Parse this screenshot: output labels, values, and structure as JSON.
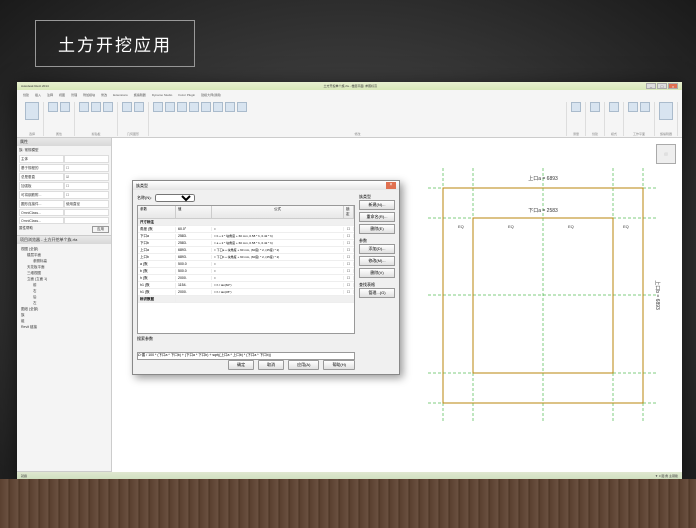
{
  "slide_title": "土方开挖应用",
  "app": {
    "title_left": "Autodesk Revit 2014",
    "title_doc": "土方开挖单个族.rfa - 楼层平面: 参照标高",
    "search_placeholder": "输入关键字或短语",
    "ribbon_tabs": [
      "创建",
      "插入",
      "注释",
      "视图",
      "管理",
      "附加模块",
      "修改",
      "Extensions",
      "族编辑器",
      "Dynamo Studio",
      "Fuzor Plugin",
      "建模大师(通用)"
    ],
    "ribbon_groups": [
      {
        "label": "选择"
      },
      {
        "label": "属性"
      },
      {
        "label": "剪贴板"
      },
      {
        "label": "几何图形"
      },
      {
        "label": "修改"
      },
      {
        "label": "测量"
      },
      {
        "label": "创建"
      },
      {
        "label": "模式"
      },
      {
        "label": "工作平面"
      },
      {
        "label": "族编辑器"
      }
    ]
  },
  "props_panel": {
    "title": "属性",
    "type_label": "族: 常规模型",
    "edit_type": "编辑类型",
    "groups": {
      "约束": "约束",
      "结构": "结构",
      "尺寸标注": "尺寸标注",
      "标识数据": "标识数据"
    },
    "rows": [
      {
        "k": "主体",
        "v": ""
      },
      {
        "k": "基于规程的",
        "v": "☐"
      },
      {
        "k": "总是垂直",
        "v": "☑"
      },
      {
        "k": "加强板",
        "v": "☐"
      },
      {
        "k": "可将钢筋附...",
        "v": "☐"
      },
      {
        "k": "圆形连接件...",
        "v": "使用直径"
      },
      {
        "k": "OmniClass...",
        "v": ""
      },
      {
        "k": "OmniClass...",
        "v": ""
      }
    ],
    "apply": "属性帮助",
    "apply_btn": "应用"
  },
  "browser_panel": {
    "title": "项目浏览器 - 土方开挖单个族.rfa",
    "nodes": [
      {
        "t": "视图 (全部)",
        "lvl": 1
      },
      {
        "t": "楼层平面",
        "lvl": 2
      },
      {
        "t": "参照标高",
        "lvl": 3
      },
      {
        "t": "天花板平面",
        "lvl": 2
      },
      {
        "t": "三维视图",
        "lvl": 2
      },
      {
        "t": "立面 (立面 1)",
        "lvl": 2
      },
      {
        "t": "前",
        "lvl": 3
      },
      {
        "t": "右",
        "lvl": 3
      },
      {
        "t": "后",
        "lvl": 3
      },
      {
        "t": "左",
        "lvl": 3
      },
      {
        "t": "图纸 (全部)",
        "lvl": 1
      },
      {
        "t": "族",
        "lvl": 1
      },
      {
        "t": "组",
        "lvl": 1
      },
      {
        "t": "Revit 链接",
        "lvl": 1
      }
    ]
  },
  "dialog": {
    "title": "族类型",
    "name_label": "名称(N):",
    "columns": {
      "param": "参数",
      "value": "值",
      "formula": "公式",
      "lock": "锁定"
    },
    "sections": {
      "dim": "尺寸标注",
      "id": "标识数据"
    },
    "rows": [
      {
        "p": "角度 (默",
        "v": "60.0°",
        "f": "="
      },
      {
        "p": "下口a",
        "v": "2583.",
        "f": "= b + 2 * 块角度 + 60 mm, 0.58 * h, 0.42 * h)"
      },
      {
        "p": "下口b",
        "v": "2583.",
        "f": "= a + 2 * 块角度 + 60 mm, 0.58 * h, 0.42 * h)"
      },
      {
        "p": "上口a",
        "v": "6893.",
        "f": "= 下口a + 块角度 + 60 mm, (60度) * 2, (45度) * 2)"
      },
      {
        "p": "上口b",
        "v": "6893.",
        "f": "= 下口b + 块角度 + 60 mm, (60度) * 2, (45度) * 2)"
      },
      {
        "p": "a (默",
        "v": "500.0",
        "f": "="
      },
      {
        "p": "b (默",
        "v": "500.0",
        "f": "="
      },
      {
        "p": "h (默",
        "v": "2000.",
        "f": "="
      },
      {
        "p": "h1 (默",
        "v": "1154.",
        "f": "= h / tan(60°)"
      },
      {
        "p": "h1 (默",
        "v": "2000.",
        "f": "= h / tan(45°)"
      }
    ],
    "lookup_label": "搜索参数",
    "lookup_formula": "Ω·善 / 100 * (下口a * 下口b) + (下口a * 下口b) + sqrt((上口a * 上口b) * (下口a * 下口b))",
    "side_labels": {
      "type": "族类型",
      "new": "新建(N)...",
      "rename": "重命名(R)...",
      "delete": "删除(E)",
      "params": "参数",
      "add": "添加(D)...",
      "modify": "修改(M)...",
      "remove": "删除(V)",
      "lookup": "查找表格",
      "manage": "管理...(G)"
    },
    "buttons": {
      "ok": "确定",
      "cancel": "取消",
      "apply": "应用(A)",
      "help": "帮助(H)"
    }
  },
  "drawing": {
    "dim_top": "上口a = 6893",
    "dim_mid": "下口a = 2583",
    "dim_side": "上口b = 6893",
    "eq": "EQ"
  },
  "status": {
    "left": "就绪",
    "right": "▼ 0 图 角 主钢筋"
  }
}
